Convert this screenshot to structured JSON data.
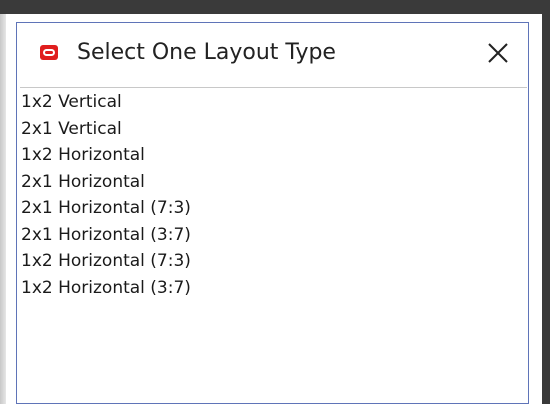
{
  "dialog": {
    "title": "Select One Layout Type",
    "icon": "oracle-app-icon",
    "close_icon": "close-icon",
    "accent_color": "#e01e1e",
    "border_color": "#5f74b8"
  },
  "layouts": {
    "items": [
      {
        "label": "1x2 Vertical"
      },
      {
        "label": "2x1 Vertical"
      },
      {
        "label": "1x2 Horizontal"
      },
      {
        "label": "2x1 Horizontal"
      },
      {
        "label": "2x1 Horizontal (7:3)"
      },
      {
        "label": "2x1 Horizontal (3:7)"
      },
      {
        "label": "1x2 Horizontal (7:3)"
      },
      {
        "label": "1x2 Horizontal (3:7)"
      }
    ]
  }
}
